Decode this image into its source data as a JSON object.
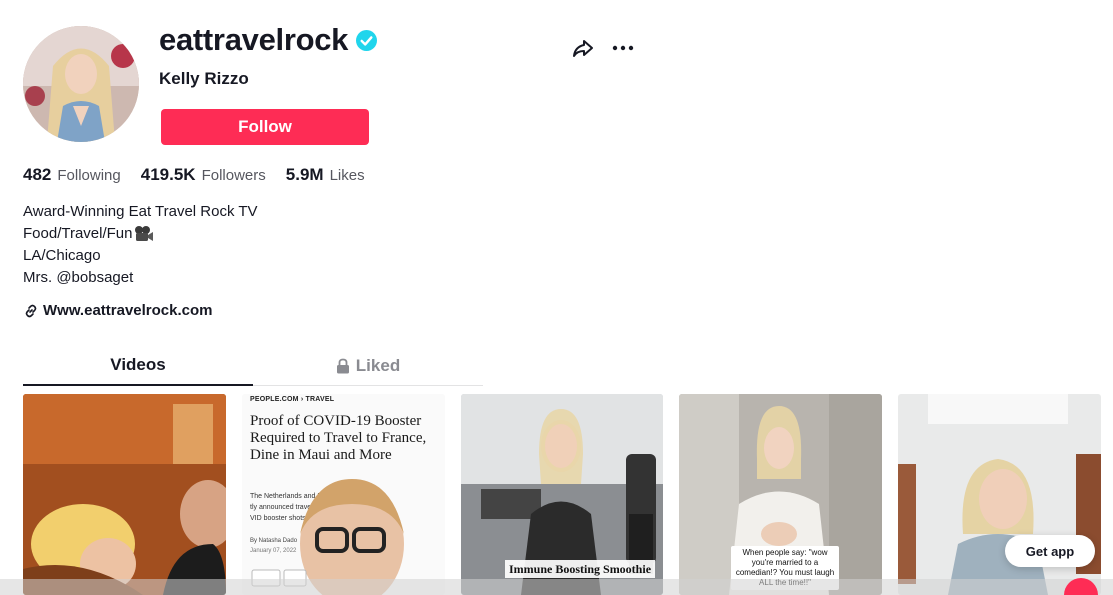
{
  "profile": {
    "username": "eattravelrock",
    "nickname": "Kelly Rizzo",
    "follow_label": "Follow",
    "verified": true
  },
  "stats": [
    {
      "value": "482",
      "label": "Following"
    },
    {
      "value": "419.5K",
      "label": "Followers"
    },
    {
      "value": "5.9M",
      "label": "Likes"
    }
  ],
  "bio": {
    "lines": [
      "Award-Winning Eat Travel Rock TV",
      "Food/Travel/Fun",
      "LA/Chicago",
      "Mrs. @bobsaget"
    ]
  },
  "link": {
    "text": "Www.eattravelrock.com"
  },
  "tabs": [
    {
      "label": "Videos",
      "active": true
    },
    {
      "label": "Liked",
      "active": false,
      "locked": true
    }
  ],
  "videos": {
    "article": {
      "source": "PEOPLE.COM  ›  TRAVEL",
      "title": "Proof of COVID-19 Booster Required to Travel to France, Dine in Maui and More",
      "body": "The Netherlands and D... tly announced travel p... VID booster shots",
      "byline": "By Natasha Dado",
      "date": "January 07, 2022"
    },
    "caption_3": "Immune Boosting Smoothie",
    "caption_4": "When people say: \"wow you're married to a comedian!? You must laugh ALL the time!!\""
  },
  "get_app_label": "Get app",
  "colors": {
    "accent": "#fe2c55",
    "verified": "#20d5ec",
    "text": "#161823",
    "muted": "#56575f"
  },
  "icons": [
    "verified-badge-icon",
    "share-icon",
    "more-icon",
    "link-icon",
    "lock-icon",
    "camera-emoji-icon"
  ]
}
